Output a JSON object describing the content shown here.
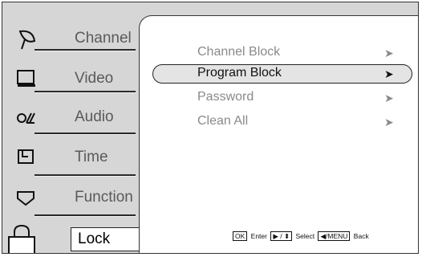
{
  "sidebar": {
    "items": [
      {
        "label": "Channel",
        "icon": "satellite-dish-icon"
      },
      {
        "label": "Video",
        "icon": "monitor-icon"
      },
      {
        "label": "Audio",
        "icon": "audio-icon"
      },
      {
        "label": "Time",
        "icon": "clock-icon"
      },
      {
        "label": "Function",
        "icon": "function-icon"
      }
    ],
    "selected": {
      "label": "Lock",
      "icon": "padlock-icon"
    }
  },
  "content": {
    "options": [
      {
        "label": "Channel Block",
        "arrow": "➤"
      },
      {
        "label": "Program Block",
        "arrow": "➤",
        "selected": true
      },
      {
        "label": "Password",
        "arrow": "➤"
      },
      {
        "label": "Clean All",
        "arrow": "➤"
      }
    ]
  },
  "footer": {
    "ok_key": "OK",
    "enter_label": "Enter",
    "nav_key": "▶ / ⬍",
    "select_label": "Select",
    "menu_key": "◀/MENU",
    "back_label": "Back"
  }
}
